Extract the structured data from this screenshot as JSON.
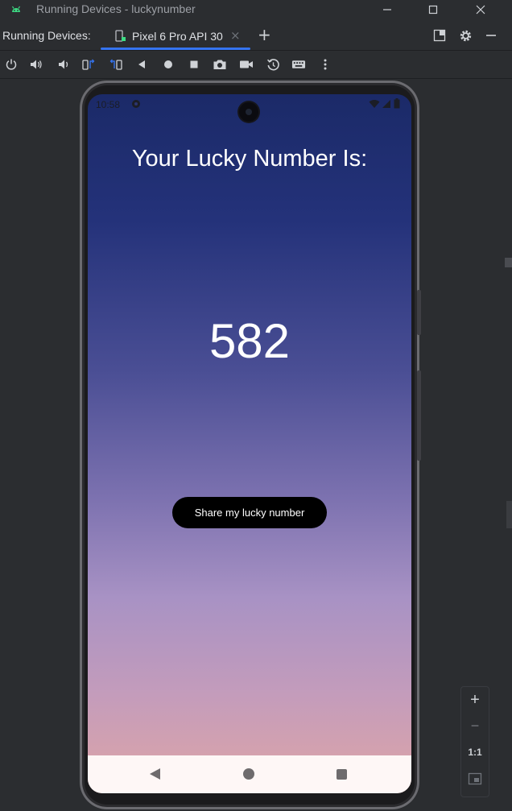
{
  "window": {
    "title": "Running Devices - luckynumber"
  },
  "tabs_row": {
    "label": "Running Devices:",
    "tab_label": "Pixel 6 Pro API 30",
    "tab_close": "×",
    "add": "+"
  },
  "toolbar_icons": [
    "power-icon",
    "volume-up-icon",
    "volume-down-icon",
    "rotate-left-icon",
    "rotate-right-icon",
    "back-icon",
    "home-icon",
    "overview-icon",
    "screenshot-icon",
    "screen-record-icon",
    "reset-icon",
    "keyboard-icon",
    "more-icon"
  ],
  "phone": {
    "status_time": "10:58",
    "headline": "Your Lucky Number Is:",
    "lucky_number": "582",
    "share_button": "Share my lucky number"
  },
  "zoom": {
    "zoom_in": "+",
    "zoom_out": "−",
    "actual_size": "1:1"
  },
  "colors": {
    "accent": "#3574f0",
    "android_green": "#3ddc84"
  }
}
